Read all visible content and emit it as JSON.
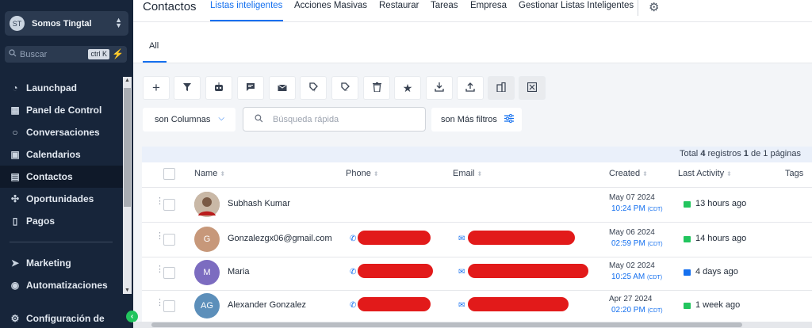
{
  "sidebar": {
    "account_name": "Somos Tingtal",
    "account_avatar": "ST",
    "search_placeholder": "Buscar",
    "search_shortcut": "ctrl K",
    "items": [
      {
        "label": "Launchpad",
        "icon": "rocket-icon"
      },
      {
        "label": "Panel de Control",
        "icon": "dashboard-icon"
      },
      {
        "label": "Conversaciones",
        "icon": "chat-icon"
      },
      {
        "label": "Calendarios",
        "icon": "calendar-icon"
      },
      {
        "label": "Contactos",
        "icon": "contacts-icon",
        "active": true
      },
      {
        "label": "Oportunidades",
        "icon": "opportunities-icon"
      },
      {
        "label": "Pagos",
        "icon": "payments-icon"
      },
      {
        "label": "Marketing",
        "icon": "send-icon"
      },
      {
        "label": "Automatizaciones",
        "icon": "automation-icon"
      },
      {
        "label": "Configuración de",
        "icon": "settings-icon"
      }
    ]
  },
  "header": {
    "title": "Contactos",
    "tabs": [
      {
        "label": "Listas inteligentes",
        "active": true
      },
      {
        "label": "Acciones Masivas"
      },
      {
        "label": "Restaurar"
      },
      {
        "label": "Tareas"
      },
      {
        "label": "Empresa"
      },
      {
        "label": "Gestionar Listas Inteligentes"
      }
    ]
  },
  "subtabs": {
    "all": "All"
  },
  "toolbar": {
    "icons": [
      "add-icon",
      "filter-icon",
      "robot-icon",
      "message-icon",
      "mail-icon",
      "add-tag-icon",
      "remove-tag-icon",
      "delete-icon",
      "star-icon",
      "import-icon",
      "export-icon",
      "company-icon",
      "merge-icon"
    ]
  },
  "filters": {
    "columns_label": "son Columnas",
    "search_placeholder": "Búsqueda rápida",
    "more_filters_label": "son Más filtros"
  },
  "table": {
    "total_prefix": "Total",
    "total_count": "4",
    "total_mid": "registros",
    "page": "1",
    "total_of": "de",
    "pages": "1",
    "total_suffix": "páginas",
    "columns": [
      "Name",
      "Phone",
      "Email",
      "Created",
      "Last Activity",
      "Tags"
    ],
    "rows": [
      {
        "initials": "",
        "avatar_color": "#9a8574",
        "name": "Subhash Kumar",
        "has_contact": false,
        "date": "May 07 2024",
        "time": "10:24 PM",
        "tz": "(CDT)",
        "activity": "13 hours ago",
        "activity_type": "sms",
        "phone_redact_w": 0,
        "email_redact_w": 0
      },
      {
        "initials": "G",
        "avatar_color": "#c7987a",
        "name": "Gonzalezgx06@gmail.com",
        "has_contact": true,
        "date": "May 06 2024",
        "time": "02:59 PM",
        "tz": "(CDT)",
        "activity": "14 hours ago",
        "activity_type": "sms",
        "phone_redact_w": 92,
        "email_redact_w": 135
      },
      {
        "initials": "M",
        "avatar_color": "#7c6cc0",
        "name": "Maria",
        "has_contact": true,
        "date": "May 02 2024",
        "time": "10:25 AM",
        "tz": "(CDT)",
        "activity": "4 days ago",
        "activity_type": "email",
        "phone_redact_w": 95,
        "email_redact_w": 152
      },
      {
        "initials": "AG",
        "avatar_color": "#5c8fba",
        "name": "Alexander Gonzalez",
        "has_contact": true,
        "date": "Apr 27 2024",
        "time": "02:20 PM",
        "tz": "(CDT)",
        "activity": "1 week ago",
        "activity_type": "sms",
        "phone_redact_w": 92,
        "email_redact_w": 127
      }
    ]
  },
  "colors": {
    "accent": "#1570ef",
    "sidebar_bg": "#17253a",
    "sms_green": "#22c55e",
    "redaction": "#e21a1a"
  }
}
